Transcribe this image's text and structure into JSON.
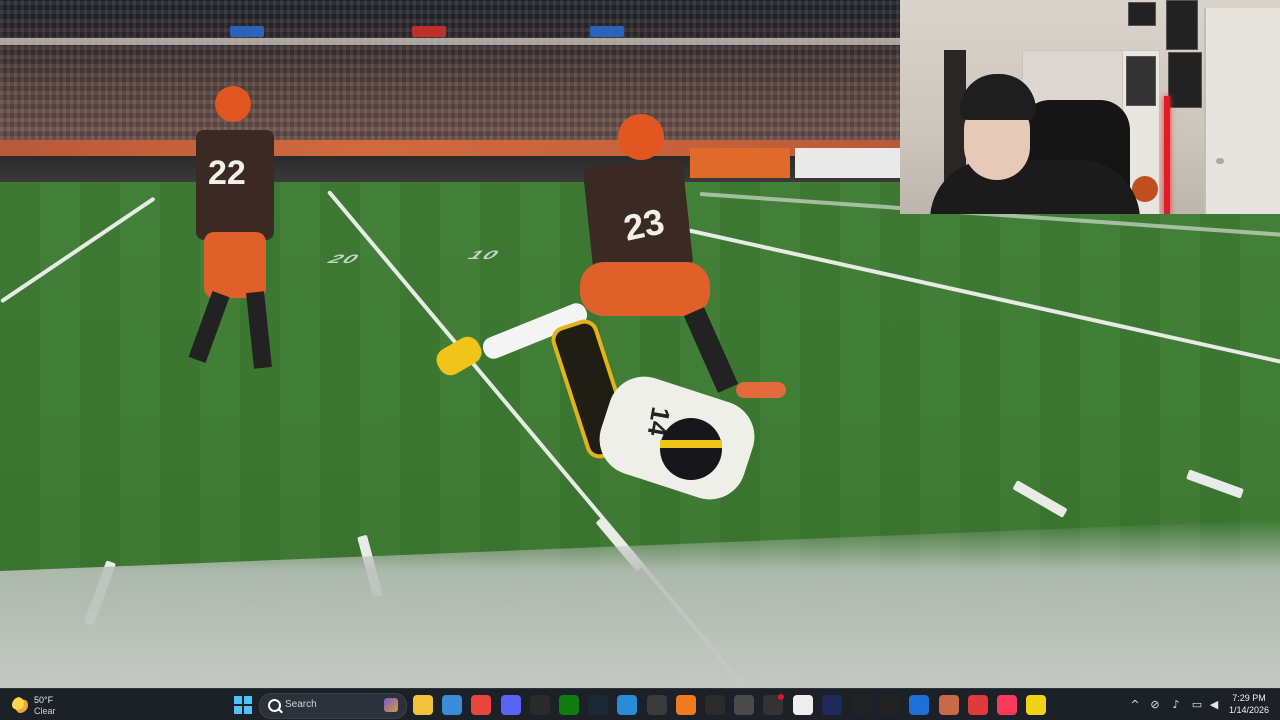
{
  "video": {
    "scene": "football-field",
    "players": [
      {
        "team": "brown-orange",
        "number": "22"
      },
      {
        "team": "brown-orange",
        "number": "23"
      },
      {
        "team": "white-gold",
        "number": "14"
      }
    ],
    "field_numbers": [
      "20",
      "10"
    ]
  },
  "webcam": {
    "present": true
  },
  "taskbar": {
    "weather": {
      "temp": "50°F",
      "condition": "Clear",
      "icon": "moon-cloud-icon"
    },
    "search": {
      "placeholder": "Search"
    },
    "apps": [
      {
        "name": "file-explorer-icon",
        "color": "#f2c23a"
      },
      {
        "name": "store-icon",
        "color": "#3a8bd8"
      },
      {
        "name": "chrome-icon",
        "color": "#e8453c"
      },
      {
        "name": "discord-icon",
        "color": "#5865f2"
      },
      {
        "name": "epic-games-icon",
        "color": "#2a2a2a"
      },
      {
        "name": "xbox-icon",
        "color": "#107c10"
      },
      {
        "name": "steam-icon",
        "color": "#1b2838"
      },
      {
        "name": "edge-icon",
        "color": "#2a8cd8"
      },
      {
        "name": "minecraft-icon",
        "color": "#3a3a3a"
      },
      {
        "name": "app-orange-icon",
        "color": "#f07a1e"
      },
      {
        "name": "obs-icon",
        "color": "#2b2b2b"
      },
      {
        "name": "settings-icon",
        "color": "#4a4a4a"
      },
      {
        "name": "app-red-dot-icon",
        "color": "#333333"
      },
      {
        "name": "app-white-icon",
        "color": "#eeeeee"
      },
      {
        "name": "app-dark-icon",
        "color": "#1e2a5a"
      },
      {
        "name": "4k-icon",
        "color": "#222222"
      },
      {
        "name": "capcut-icon",
        "color": "#222222"
      },
      {
        "name": "app-blue-icon",
        "color": "#1e6fd8"
      },
      {
        "name": "app-photo-icon",
        "color": "#c86a4a"
      },
      {
        "name": "app-red-icon",
        "color": "#e03a3a"
      },
      {
        "name": "music-icon",
        "color": "#fa3a5a"
      },
      {
        "name": "app-yellow-icon",
        "color": "#f0d21a"
      }
    ],
    "clock": {
      "time": "7:29 PM",
      "date": "1/14/2026"
    }
  }
}
